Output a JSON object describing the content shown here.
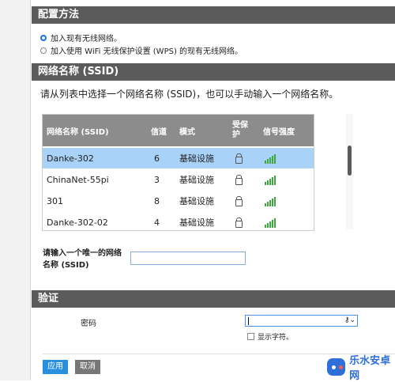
{
  "config": {
    "title": "配置方法",
    "option1": "加入现有无线网络。",
    "option2": "加入使用 WiFi 无线保护设置 (WPS) 的现有无线网络。"
  },
  "ssid_section": {
    "title": "网络名称 (SSID)",
    "description": "请从列表中选择一个网络名称 (SSID)，也可以手动输入一个网络名称。",
    "columns": [
      "网络名称 (SSID)",
      "信道",
      "模式",
      "受保护",
      "信号强度"
    ],
    "rows": [
      {
        "name": "Danke-302",
        "channel": "6",
        "mode": "基础设施",
        "secured": "lock-icon",
        "signal": "full"
      },
      {
        "name": "ChinaNet-55pi",
        "channel": "3",
        "mode": "基础设施",
        "secured": "lock-icon",
        "signal": "full"
      },
      {
        "name": "301",
        "channel": "8",
        "mode": "基础设施",
        "secured": "lock-icon",
        "signal": "full"
      },
      {
        "name": "Danke-302-02",
        "channel": "4",
        "mode": "基础设施",
        "secured": "lock-icon",
        "signal": "full"
      }
    ],
    "selected_row": 0,
    "manual_label": "请输入一个唯一的网络名称 (SSID)",
    "manual_value": ""
  },
  "auth": {
    "title": "验证",
    "password_label": "密码",
    "show_chars": "显示字符。"
  },
  "buttons": {
    "apply": "应用",
    "cancel": "取消"
  },
  "watermark": {
    "text": "乐水安卓网"
  },
  "colors": {
    "accent": "#2990dd",
    "header": "#5b5b5b",
    "selected": "#a8d2f7",
    "signal": "#3da63d"
  }
}
